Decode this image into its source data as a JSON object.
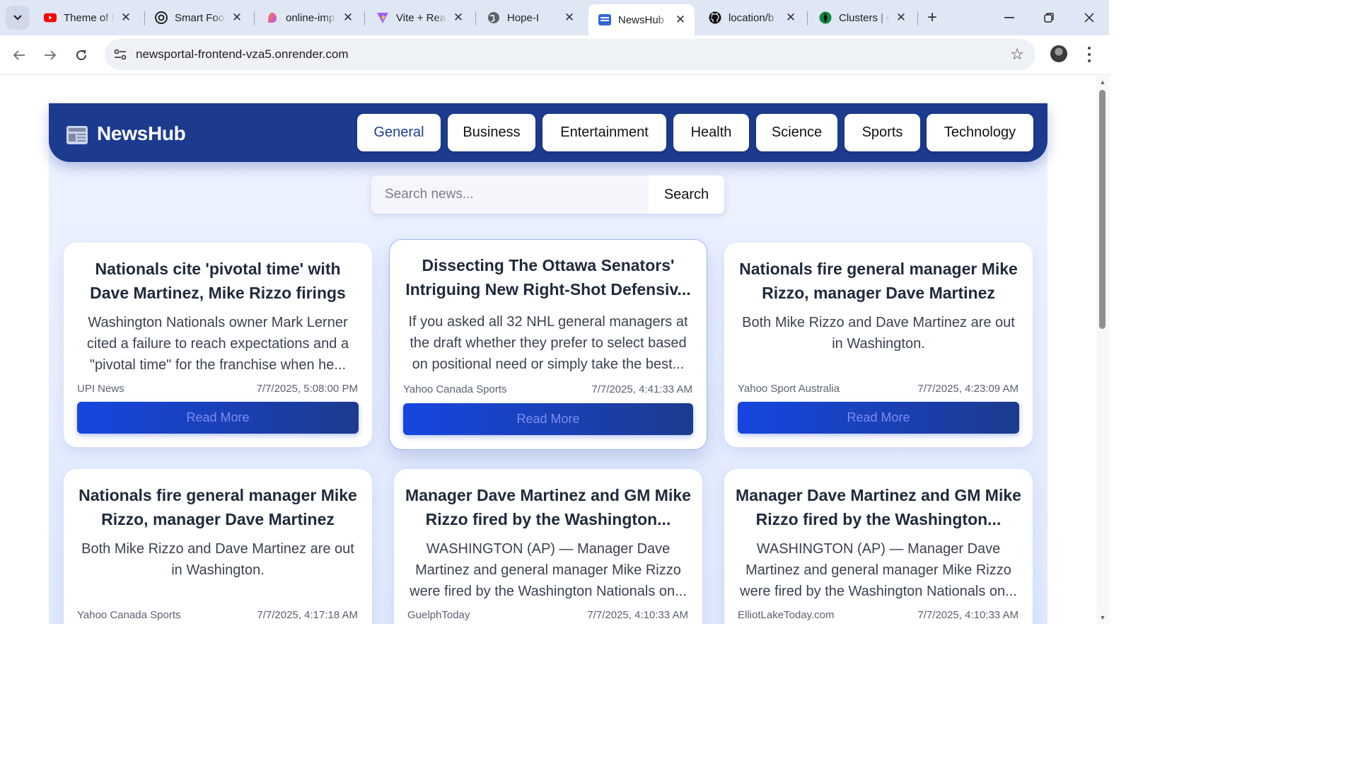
{
  "browser": {
    "tabs": [
      {
        "title": "Theme of K",
        "favicon": "youtube-icon",
        "color": "#ff0000"
      },
      {
        "title": "Smart Food",
        "favicon": "openai-icon",
        "color": "#222222"
      },
      {
        "title": "online-imp",
        "favicon": "lovable-icon",
        "color": "#e14bd0"
      },
      {
        "title": "Vite + Rea",
        "favicon": "vite-icon",
        "color": "#9d61ff"
      },
      {
        "title": "Hope-I",
        "favicon": "globe-icon",
        "color": "#5f6368"
      },
      {
        "title": "NewsHub",
        "favicon": "newspaper-icon",
        "color": "#3367d6",
        "active": true
      },
      {
        "title": "location/b",
        "favicon": "github-icon",
        "color": "#111111"
      },
      {
        "title": "Clusters | C",
        "favicon": "mongodb-icon",
        "color": "#0b8a3e"
      }
    ],
    "url": "newsportal-frontend-vza5.onrender.com"
  },
  "app": {
    "brand": "NewsHub",
    "categories": [
      "General",
      "Business",
      "Entertainment",
      "Health",
      "Science",
      "Sports",
      "Technology"
    ],
    "active_category": "General",
    "search": {
      "placeholder": "Search news...",
      "button": "Search"
    },
    "read_more_label": "Read More",
    "articles": [
      {
        "title": "Nationals cite 'pivotal time' with Dave Martinez, Mike Rizzo firings",
        "description": "Washington Nationals owner Mark Lerner cited a failure to reach expectations and a \"pivotal time\" for the franchise when he...",
        "source": "UPI News",
        "date": "7/7/2025, 5:08:00 PM"
      },
      {
        "title": "Dissecting The Ottawa Senators' Intriguing New Right-Shot Defensiv...",
        "description": "If you asked all 32 NHL general managers at the draft whether they prefer to select based on positional need or simply take the best...",
        "source": "Yahoo Canada Sports",
        "date": "7/7/2025, 4:41:33 AM"
      },
      {
        "title": "Nationals fire general manager Mike Rizzo, manager Dave Martinez",
        "description": "Both Mike Rizzo and Dave Martinez are out in Washington.",
        "source": "Yahoo Sport Australia",
        "date": "7/7/2025, 4:23:09 AM"
      },
      {
        "title": "Nationals fire general manager Mike Rizzo, manager Dave Martinez",
        "description": "Both Mike Rizzo and Dave Martinez are out in Washington.",
        "source": "Yahoo Canada Sports",
        "date": "7/7/2025, 4:17:18 AM"
      },
      {
        "title": "Manager Dave Martinez and GM Mike Rizzo fired by the Washington...",
        "description": "WASHINGTON (AP) — Manager Dave Martinez and general manager Mike Rizzo were fired by the Washington Nationals on...",
        "source": "GuelphToday",
        "date": "7/7/2025, 4:10:33 AM"
      },
      {
        "title": "Manager Dave Martinez and GM Mike Rizzo fired by the Washington...",
        "description": "WASHINGTON (AP) — Manager Dave Martinez and general manager Mike Rizzo were fired by the Washington Nationals on...",
        "source": "ElliotLakeToday.com",
        "date": "7/7/2025, 4:10:33 AM"
      }
    ]
  },
  "colors": {
    "header_bg": "#1c3b8f",
    "accent": "#1646e0",
    "page_bg": "#e6eefe"
  }
}
